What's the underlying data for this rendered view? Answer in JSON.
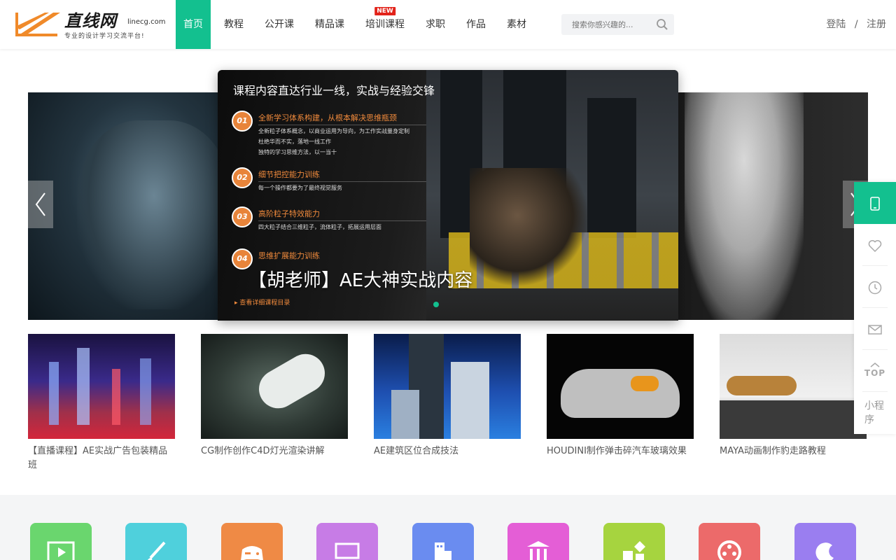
{
  "header": {
    "logo": {
      "name": "直线网",
      "domain": "linecg.com",
      "slogan": "专业的设计学习交流平台!"
    },
    "nav": [
      {
        "label": "首页",
        "active": true
      },
      {
        "label": "教程"
      },
      {
        "label": "公开课"
      },
      {
        "label": "精品课"
      },
      {
        "label": "培训课程",
        "tag": "NEW"
      },
      {
        "label": "求职"
      },
      {
        "label": "作品"
      },
      {
        "label": "素材"
      }
    ],
    "search": {
      "placeholder": "搜索你感兴趣的...",
      "icon": "search-icon"
    },
    "auth": {
      "login": "登陆",
      "separator": "/",
      "register": "注册"
    }
  },
  "carousel": {
    "heading": "课程内容直达行业一线，实战与经验交锋",
    "points": [
      {
        "num": "01",
        "title": "全新学习体系构建，从根本解决思维瓶颈",
        "desc": [
          "全新粒子体系概念，以商业运用为导向，为工作实战量身定制",
          "杜绝华而不实，落地一线工作",
          "独特的学习思维方法，以一当十"
        ]
      },
      {
        "num": "02",
        "title": "细节把控能力训练",
        "desc": [
          "每一个操作都要为了最终视觉服务"
        ]
      },
      {
        "num": "03",
        "title": "高阶粒子特效能力",
        "desc": [
          "四大粒子结合三维粒子，流体粒子，拓展运用层面"
        ]
      },
      {
        "num": "04",
        "title": "思维扩展能力训练",
        "desc": []
      }
    ],
    "caption": "【胡老师】AE大神实战内容",
    "more_link": "查看详细课程目录",
    "prev_icon": "chevron-left-icon",
    "next_icon": "chevron-right-icon",
    "active_dot_color": "#13c08f"
  },
  "thumbnails": [
    {
      "title": "【直播课程】AE实战广告包装精品班"
    },
    {
      "title": "CG制作创作C4D灯光渲染讲解"
    },
    {
      "title": "AE建筑区位合成技法"
    },
    {
      "title": "HOUDINI制作弹击碎汽车玻璃效果"
    },
    {
      "title": "MAYA动画制作豹走路教程"
    }
  ],
  "sidebar": {
    "items": [
      "tablet-icon",
      "heart-icon",
      "clock-icon",
      "mail-icon"
    ],
    "top_label": "TOP",
    "mini_program": "小程序"
  },
  "categories": [
    {
      "icon": "film-icon",
      "color": "#6ad66e"
    },
    {
      "icon": "brush-icon",
      "color": "#4fd0dc"
    },
    {
      "icon": "gamepad-icon",
      "color": "#ef8a45"
    },
    {
      "icon": "monitor-icon",
      "color": "#c77ce6"
    },
    {
      "icon": "building-icon",
      "color": "#6a8cf0"
    },
    {
      "icon": "museum-icon",
      "color": "#e45ed6"
    },
    {
      "icon": "shapes-icon",
      "color": "#a6d43f"
    },
    {
      "icon": "film-reel-icon",
      "color": "#ec6a6a"
    },
    {
      "icon": "moon-icon",
      "color": "#9a7ef0"
    }
  ],
  "colors": {
    "accent": "#13c08f",
    "new_tag": "#e2231a",
    "highlight": "#f08a3c"
  }
}
